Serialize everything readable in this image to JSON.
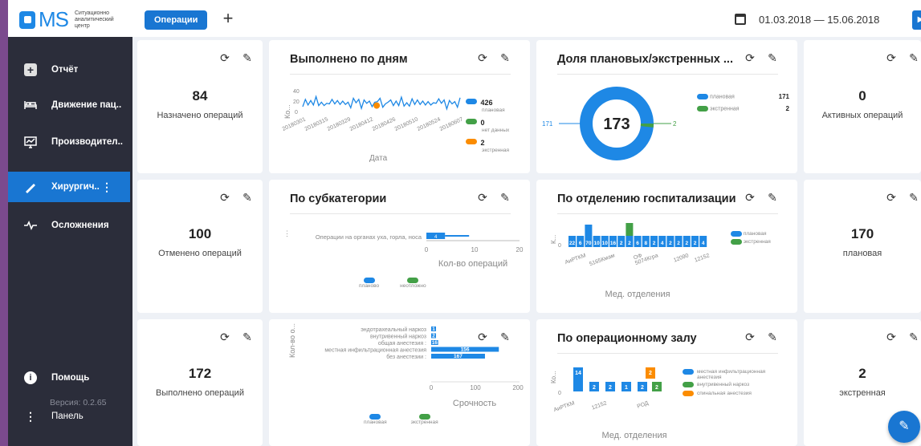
{
  "header": {
    "logo_text": "MS",
    "logo_subtitle": "Ситуационно аналитический центр",
    "tab_label": "Операции",
    "add_label": "+",
    "date_range": "01.03.2018  —  15.06.2018"
  },
  "sidebar": {
    "items": [
      {
        "label": "Отчёт",
        "icon": "plus-box-icon"
      },
      {
        "label": "Движение пац..",
        "icon": "bed-icon"
      },
      {
        "label": "Производител..",
        "icon": "chart-monitor-icon"
      },
      {
        "label": "Хирургич..",
        "icon": "scalpel-icon"
      },
      {
        "label": "Осложнения",
        "icon": "pulse-icon"
      }
    ],
    "help_label": "Помощь",
    "panel_label": "Панель",
    "version": "Версия: 0.2.65"
  },
  "kpis": {
    "assigned": {
      "value": "84",
      "label": "Назначено операций"
    },
    "active": {
      "value": "0",
      "label": "Активных операций"
    },
    "cancelled": {
      "value": "100",
      "label": "Отменено операций"
    },
    "planned": {
      "value": "170",
      "label": "плановая"
    },
    "done": {
      "value": "172",
      "label": "Выполнено операций"
    },
    "emergency": {
      "value": "2",
      "label": "экстренная"
    }
  },
  "chart_data": [
    {
      "type": "line",
      "title": "Выполнено по дням",
      "xlabel": "Дата",
      "ylabel": "Ко...",
      "yticks": [
        "40",
        "20",
        "0"
      ],
      "ylim": [
        0,
        40
      ],
      "x": [
        "20180301",
        "20180315",
        "20180329",
        "20180412",
        "20180426",
        "20180510",
        "20180524",
        "20180607"
      ],
      "series": [
        {
          "name": "плановая",
          "color": "#1e88e5",
          "values": [
            14,
            20,
            12,
            22,
            16,
            24,
            10,
            18
          ]
        },
        {
          "name": "нет данных",
          "color": "#43a047",
          "values": []
        },
        {
          "name": "экстренная",
          "color": "#fb8c00",
          "values": [
            12
          ]
        }
      ],
      "legend_values": [
        "426",
        "0",
        "2"
      ],
      "legend_placement": "right"
    },
    {
      "type": "pie",
      "title": "Доля плановых/экстренных ...",
      "center_label": "173",
      "side_labels": [
        "171",
        "2"
      ],
      "series": [
        {
          "name": "плановая",
          "color": "#1e88e5",
          "value": 171
        },
        {
          "name": "экстренная",
          "color": "#43a047",
          "value": 2
        }
      ],
      "legend_placement": "right"
    },
    {
      "type": "bar",
      "title": "По субкатегории",
      "categories": [
        "Операции на органах уха, горла, носа"
      ],
      "xlabel": "Кол-во операций",
      "xticks": [
        "0",
        "10",
        "20"
      ],
      "series": [
        {
          "name": "планово",
          "color": "#1e88e5",
          "values": [
            4
          ]
        },
        {
          "name": "неотложно",
          "color": "#43a047",
          "values": [
            0
          ]
        }
      ],
      "legend_placement": "bottom"
    },
    {
      "type": "bar",
      "title": "По отделению госпитализации",
      "xlabel": "Мед. отделения",
      "ylabel": "К...",
      "categories": [
        "АиРТКМ",
        "5165Кмам",
        "ОФ",
        "5074Кгра",
        "12090",
        "12152"
      ],
      "bar_labels": [
        "22",
        "6",
        "70",
        "10",
        "10",
        "16",
        "2",
        "2",
        "6",
        "8",
        "2",
        "4",
        "2",
        "2",
        "2",
        "2",
        "4"
      ],
      "series": [
        {
          "name": "плановая",
          "color": "#1e88e5"
        },
        {
          "name": "экстренная",
          "color": "#43a047"
        }
      ],
      "legend_placement": "right"
    },
    {
      "type": "bar",
      "title": "",
      "ylabel": "Кол-во о...",
      "xlabel": "Срочность",
      "categories": [
        "эндотрахеальный наркоз",
        "внутривенный наркоз",
        "общая анестезия :",
        "местная инфильтрационная анестезия",
        "без анестезии :"
      ],
      "xticks": [
        "0",
        "100",
        "200"
      ],
      "bar_labels": [
        "1",
        "2",
        "16",
        "156",
        "167"
      ],
      "series": [
        {
          "name": "плановая",
          "color": "#1e88e5",
          "values": [
            8,
            6,
            16,
            156,
            124
          ]
        },
        {
          "name": "экстренная",
          "color": "#43a047",
          "values": [
            0,
            0,
            0,
            0,
            0
          ]
        }
      ],
      "legend_placement": "bottom"
    },
    {
      "type": "bar",
      "title": "По операционному залу",
      "xlabel": "Мед. отделения",
      "ylabel": "Ко...",
      "categories": [
        "АиРТКМ",
        "12152",
        "РОД"
      ],
      "bar_labels": [
        "14",
        "2",
        "2",
        "1",
        "2",
        "2",
        "2"
      ],
      "series": [
        {
          "name": "местная инфильтрационная анестезия",
          "color": "#1e88e5"
        },
        {
          "name": "внутривенный наркоз",
          "color": "#43a047"
        },
        {
          "name": "спинальная анестезия",
          "color": "#fb8c00"
        }
      ],
      "legend_placement": "right"
    }
  ],
  "colors": {
    "accent": "#1976d2",
    "sidebar": "#2b2d3a",
    "green": "#43a047",
    "orange": "#fb8c00"
  }
}
